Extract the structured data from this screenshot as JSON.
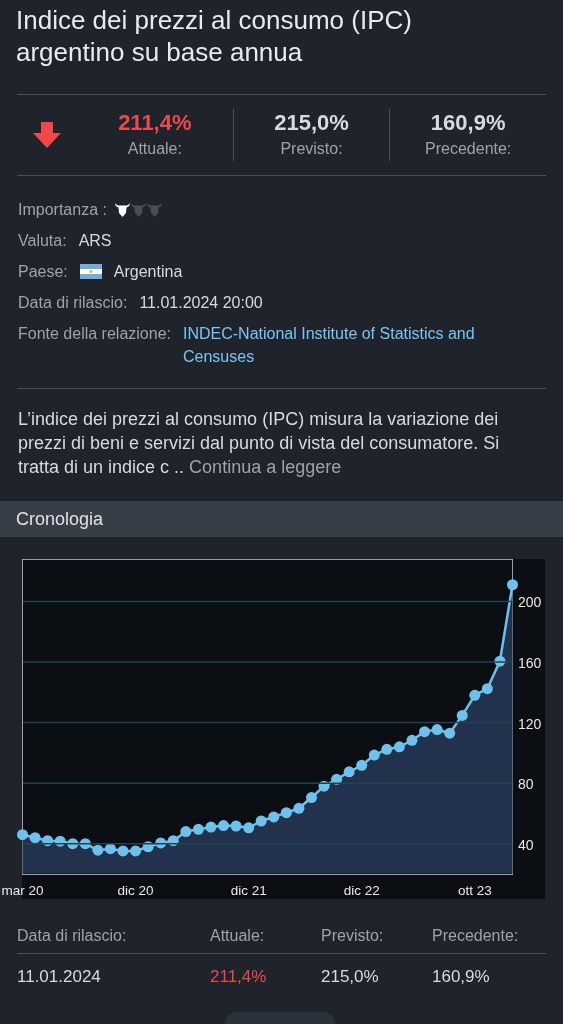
{
  "title": "Indice dei prezzi al consumo (IPC) argentino su base annua",
  "summary": {
    "below_forecast": true,
    "actual": {
      "value": "211,4%",
      "label": "Attuale:"
    },
    "forecast": {
      "value": "215,0%",
      "label": "Previsto:"
    },
    "previous": {
      "value": "160,9%",
      "label": "Precedente:"
    }
  },
  "details": {
    "importance": {
      "label": "Importanza :",
      "stars": 1
    },
    "currency": {
      "label": "Valuta:",
      "value": "ARS"
    },
    "country": {
      "label": "Paese:",
      "value": "Argentina"
    },
    "release": {
      "label": "Data di rilascio:",
      "value": "11.01.2024 20:00"
    },
    "source": {
      "label": "Fonte della relazione:",
      "value": "INDEC-National Institute of Statistics and Censuses"
    }
  },
  "description": {
    "text": "L’indice dei prezzi al consumo (IPC) misura la variazione dei prezzi di beni e servizi dal punto di vista del consumatore. Si tratta di un indice c ..",
    "link": "Continua a leggere"
  },
  "history": {
    "title": "Cronologia",
    "chart_data": {
      "type": "area",
      "categories": [
        "mar 20",
        null,
        null,
        null,
        null,
        null,
        null,
        null,
        null,
        "dic 20",
        null,
        null,
        null,
        null,
        null,
        null,
        null,
        null,
        "dic 21",
        null,
        null,
        null,
        null,
        null,
        null,
        null,
        null,
        "dic 22",
        null,
        null,
        null,
        null,
        null,
        null,
        null,
        null,
        "ott 23",
        null,
        null,
        null
      ],
      "series": [
        {
          "color": "#6ec1ec",
          "values": [
            46,
            44,
            42,
            41.7,
            40,
            40,
            35.7,
            36.7,
            35.2,
            35.2,
            38,
            40.5,
            42,
            48,
            49.5,
            51,
            52,
            51.7,
            50.5,
            55,
            57.7,
            60.5,
            63.4,
            70.5,
            78,
            82.5,
            87.5,
            91.8,
            98.5,
            102.3,
            104,
            108.3,
            114,
            115.4,
            113,
            124.7,
            138,
            142.4,
            160.5,
            211
          ]
        }
      ],
      "yticks": [
        40,
        80,
        120,
        160,
        200
      ],
      "ylim": [
        20,
        228
      ],
      "grid": true
    }
  },
  "table": {
    "columns": [
      "Data di rilascio:",
      "Attuale:",
      "Previsto:",
      "Precedente:"
    ],
    "rows": [
      {
        "date": "11.01.2024",
        "actual": "211,4%",
        "forecast": "215,0%",
        "previous": "160,9%",
        "actual_below_forecast": true
      }
    ]
  }
}
